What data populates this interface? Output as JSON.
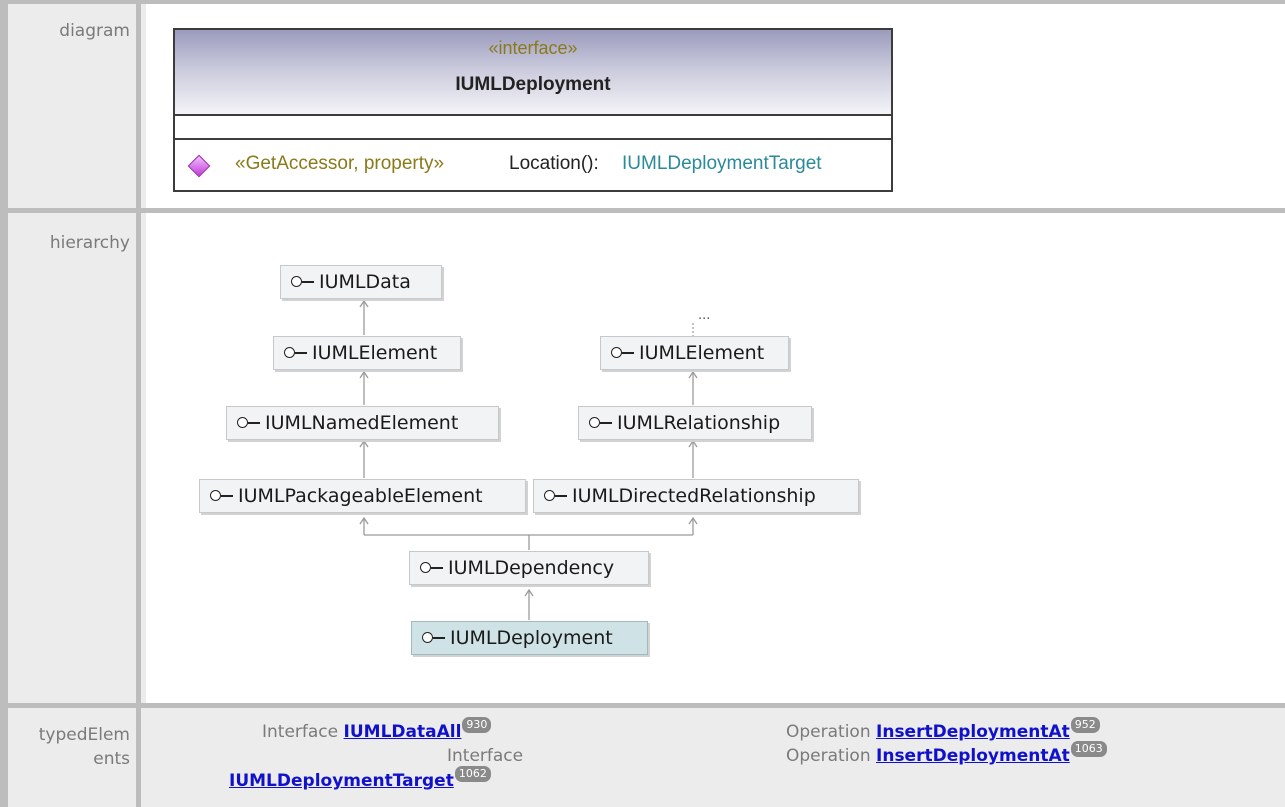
{
  "rows": {
    "diagram_label": "diagram",
    "hierarchy_label": "hierarchy",
    "typed_label_line1": "typedElem",
    "typed_label_line2": "ents"
  },
  "uml_class": {
    "stereotype": "«interface»",
    "name": "IUMLDeployment",
    "operation": {
      "stereotype": "«GetAccessor, property»",
      "name": "Location():",
      "return_type": "IUMLDeploymentTarget"
    }
  },
  "hierarchy": {
    "left_chain": [
      "IUMLData",
      "IUMLElement",
      "IUMLNamedElement",
      "IUMLPackageableElement"
    ],
    "right_chain": [
      "IUMLElement",
      "IUMLRelationship",
      "IUMLDirectedRelationship"
    ],
    "right_more": "...",
    "dependency": "IUMLDependency",
    "selected": "IUMLDeployment"
  },
  "typed_elements": [
    {
      "kind": "Interface",
      "name": "IUMLDataAll",
      "badge": "930"
    },
    {
      "kind": "Operation",
      "name": "InsertDeploymentAt",
      "badge": "952"
    },
    {
      "kind": "Interface",
      "name": "IUMLDeploymentTarget",
      "badge": "1062"
    },
    {
      "kind": "Operation",
      "name": "InsertDeploymentAt",
      "badge": "1063"
    }
  ]
}
